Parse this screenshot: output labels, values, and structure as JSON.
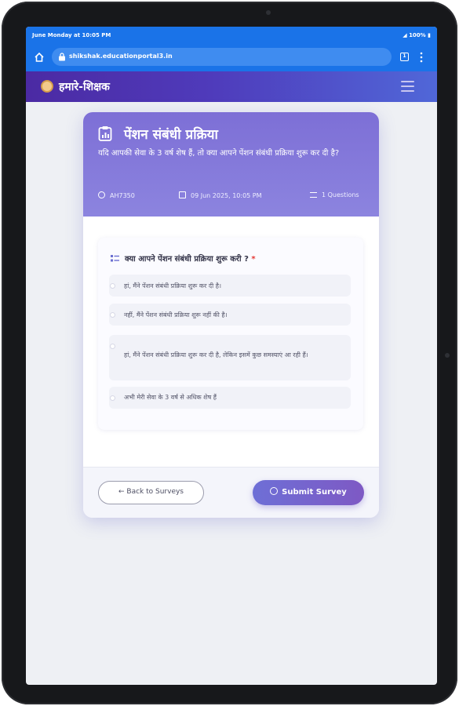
{
  "status_bar": {
    "time": "June Monday at 10:05 PM",
    "battery": "100%"
  },
  "browser": {
    "url": "shikshak.educationportal3.in",
    "tabs_count": "1"
  },
  "app": {
    "title": "हमारे-शिक्षक"
  },
  "survey": {
    "title": "पेंशन संबंधी प्रक्रिया",
    "subtitle": "यदि आपकी सेवा के 3 वर्ष शेष हैं, तो क्या आपने पेंशन संबंधी प्रक्रिया शुरू कर दी है?",
    "id": "AH7350",
    "date": "09 Jun 2025, 10:05 PM",
    "questions_count": "1 Questions",
    "question": {
      "text": "क्या आपने पेंशन संबंधी प्रक्रिया शुरू करी ?",
      "required_mark": "*",
      "options": [
        "हां, मैंने पेंशन संबंधी प्रक्रिया शुरू कर दी है।",
        "नहीं, मैंने पेंशन संबंधी प्रक्रिया शुरू नहीं की है।",
        "हां, मैंने पेंशन संबंधी प्रक्रिया शुरू कर दी है, लेकिन इसमें कुछ समस्याएं आ रही हैं।",
        "अभी मेरी सेवा के 3 वर्ष से अधिक शेष हैं"
      ]
    },
    "back_label": "Back to Surveys",
    "submit_label": "Submit Survey"
  },
  "colors": {
    "browser_bar": "#1a73e8",
    "header_gradient_start": "#4b2aa3",
    "card_header": "#7d6fd6",
    "submit_button": "#6e6fd6"
  }
}
